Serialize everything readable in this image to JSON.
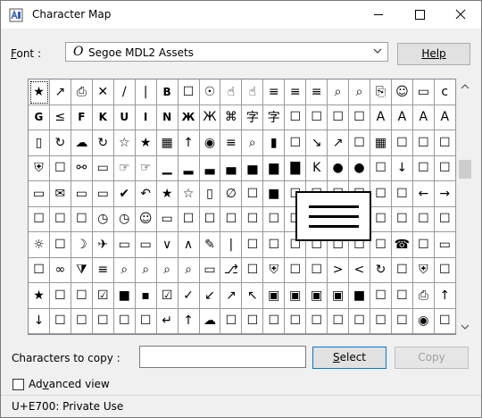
{
  "window": {
    "title": "Character Map"
  },
  "font_row": {
    "label_prefix": "",
    "label_underlined": "F",
    "label_rest": "ont :",
    "selected_font": "Segoe MDL2 Assets",
    "font_icon": "O",
    "help_label": "Help"
  },
  "grid": {
    "rows": [
      [
        "★",
        "↗",
        "⎙",
        "✕",
        "/",
        "|",
        "B",
        "☐",
        "☉",
        "☝",
        "☝",
        "≡",
        "≡",
        "≡",
        "⌕",
        "⌕",
        "⎘",
        "☺",
        "▭",
        "c"
      ],
      [
        "G",
        "≤",
        "F",
        "K",
        "U",
        "I",
        "N",
        "Ж",
        "Ж",
        "⌘",
        "字",
        "字",
        "☐",
        "☐",
        "☐",
        "☐",
        "A",
        "A",
        "A",
        "A"
      ],
      [
        "▯",
        "↻",
        "☁",
        "↻",
        "☆",
        "★",
        "▦",
        "↑",
        "◉",
        "≡",
        "⌕",
        "▮",
        "☐",
        "↘",
        "↗",
        "☐",
        "▦",
        "☐",
        "☐",
        "☐"
      ],
      [
        "⛨",
        "☐",
        "⚯",
        "▭",
        "☞",
        "☞",
        "▁",
        "▂",
        "▃",
        "▄",
        "▅",
        "▆",
        "▇",
        "K",
        "●",
        "●",
        "☐",
        "↓",
        "☐",
        "☐"
      ],
      [
        "▭",
        "✉",
        "▭",
        "▭",
        "✔",
        "↶",
        "★",
        "☆",
        "▯",
        "∅",
        "☐",
        "■",
        "☐",
        "☐",
        "☐",
        "☐",
        "☐",
        "☐",
        "←",
        "→"
      ],
      [
        "☐",
        "☐",
        "☐",
        "◷",
        "◷",
        "☺",
        "▭",
        "☐",
        "☐",
        "☐",
        "☐",
        "☐",
        "☐",
        "☐",
        "☐",
        "☐",
        "☐",
        "☐",
        "☐",
        "☐"
      ],
      [
        "☼",
        "☐",
        "☽",
        "✈",
        "▭",
        "▭",
        "∨",
        "∧",
        "✎",
        "|",
        "☐",
        "☐",
        "☐",
        "☐",
        "☐",
        "☐",
        "☐",
        "☎",
        "☐",
        "▭"
      ],
      [
        "☐",
        "∞",
        "⧩",
        "≡",
        "⌕",
        "⌕",
        "⌕",
        "⌕",
        "▭",
        "⎇",
        "☐",
        "⛨",
        "☐",
        "☐",
        ">",
        "<",
        "↻",
        "☐",
        "⛨",
        "☐"
      ],
      [
        "★",
        "☐",
        "☐",
        "☑",
        "■",
        "▪",
        "☑",
        "✓",
        "↙",
        "↗",
        "↖",
        "▣",
        "▣",
        "▣",
        "▣",
        "■",
        "☐",
        "☐",
        "⎙",
        "↑"
      ],
      [
        "↓",
        "☐",
        "☐",
        "☐",
        "☐",
        "☐",
        "↵",
        "↑",
        "☁",
        "☐",
        "☐",
        "☐",
        "☐",
        "☐",
        "☐",
        "☐",
        "☐",
        "☐",
        "◉",
        "☐"
      ]
    ],
    "bold_cells": [
      "0-6",
      "1-0",
      "1-2",
      "1-3",
      "1-4",
      "1-5",
      "1-6",
      "1-7"
    ]
  },
  "copy_row": {
    "label": "Characters to copy :",
    "value": "",
    "select_prefix": "",
    "select_underlined": "S",
    "select_rest": "elect",
    "copy_label": "Copy"
  },
  "advanced": {
    "label_underlined": "v",
    "label_prefix": "Ad",
    "label_rest": "anced view",
    "checked": false
  },
  "status": {
    "text": "U+E700: Private Use"
  }
}
